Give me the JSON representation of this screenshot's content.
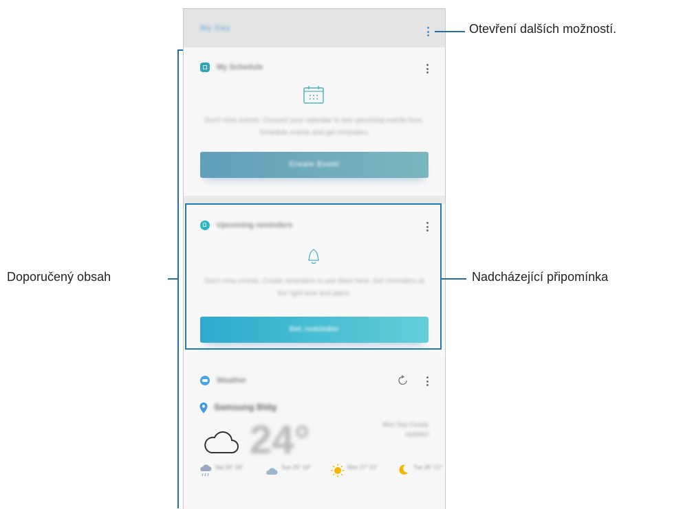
{
  "app": {
    "title": "My Day"
  },
  "cards": [
    {
      "title": "My Schedule",
      "body": "Don't miss events. Connect your calendar to see upcoming events here. Schedule events and get reminders.",
      "button": "Create Event"
    },
    {
      "title": "Upcoming reminders",
      "body": "Don't miss events. Create reminders to see them here. Get reminders at the right time and place.",
      "button": "Set reminder"
    },
    {
      "title": "Weather",
      "location": "Samsung Bldg",
      "temperature": "24°",
      "details": "Mon Sep Cloudy Updated",
      "forecast": [
        {
          "label": "Sat 24° 18°",
          "icon": "rain-cloud-icon"
        },
        {
          "label": "Sun 25° 19°",
          "icon": "cloud-icon"
        },
        {
          "label": "Mon 27° 21°",
          "icon": "sun-icon"
        },
        {
          "label": "Tue 26° 21°",
          "icon": "moon-icon"
        }
      ]
    }
  ],
  "callouts": {
    "more_options": "Otevření dalších možností.",
    "recommended": "Doporučený obsah",
    "upcoming_reminder": "Nadcházející připomínka"
  },
  "colors": {
    "accent": "#1f7ab8",
    "button_schedule": "#619fbc",
    "button_reminder": "#2eaacd",
    "badge": "#2fa7bb"
  }
}
